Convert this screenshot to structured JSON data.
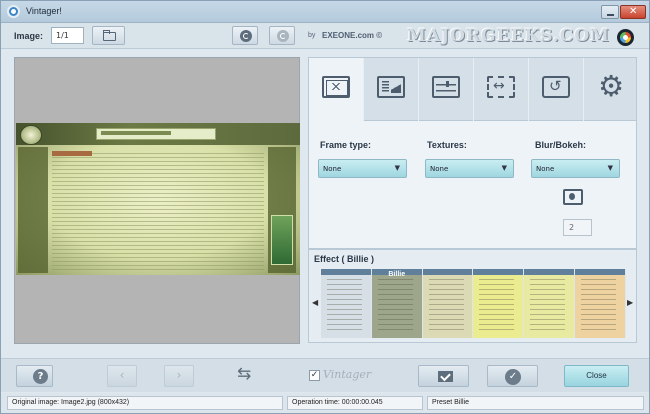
{
  "window": {
    "title": "Vintager!"
  },
  "toolbar": {
    "image_label": "Image:",
    "image_counter": "1/1",
    "brand_by": "by",
    "brand_name": "EXEONE.com ©",
    "watermark": "MAJORGEEKS.COM"
  },
  "tabs": [
    {
      "name": "frames",
      "icon": "frame-icon",
      "active": true
    },
    {
      "name": "textures",
      "icon": "texture-icon",
      "active": false
    },
    {
      "name": "adjustments",
      "icon": "sliders-icon",
      "active": false
    },
    {
      "name": "resize",
      "icon": "resize-icon",
      "active": false
    },
    {
      "name": "batch",
      "icon": "batch-icon",
      "active": false
    },
    {
      "name": "settings",
      "icon": "gear-icon",
      "active": false
    }
  ],
  "options": {
    "frame_type": {
      "label": "Frame type:",
      "value": "None"
    },
    "textures": {
      "label": "Textures:",
      "value": "None"
    },
    "blur": {
      "label": "Blur/Bokeh:",
      "value": "None",
      "amount": "2"
    }
  },
  "effects": {
    "label": "Effect ( Billie )",
    "thumbs": [
      {
        "name": "",
        "tint": "#d6dfe6"
      },
      {
        "name": "Billie",
        "tint": "#9da58a"
      },
      {
        "name": "",
        "tint": "#dcdab4"
      },
      {
        "name": "",
        "tint": "#ebeb90"
      },
      {
        "name": "",
        "tint": "#e8eaa2"
      },
      {
        "name": "",
        "tint": "#eed3a0"
      }
    ]
  },
  "bottom": {
    "vintager_check": "✓",
    "vintager_logo": "Vintager",
    "close_label": "Close"
  },
  "status": {
    "original": "Original image: Image2.jpg (800x432)",
    "operation": "Operation time: 00:00:00.045",
    "preset": "Preset Billie"
  }
}
